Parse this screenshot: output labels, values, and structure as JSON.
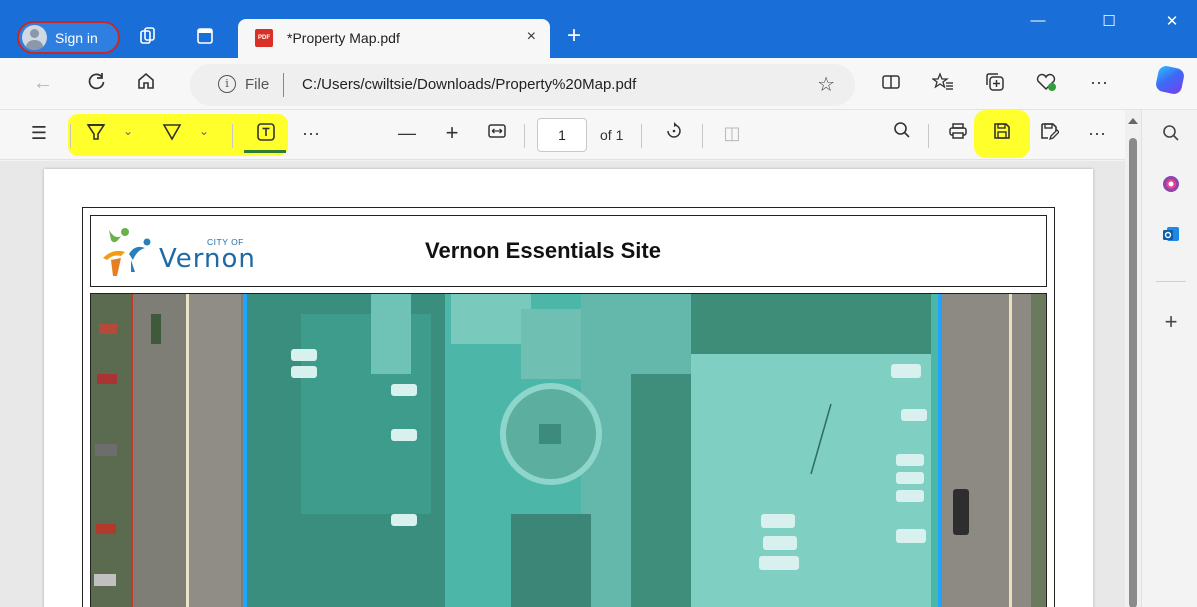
{
  "browser": {
    "sign_in_label": "Sign in",
    "tab": {
      "title": "*Property Map.pdf",
      "file_icon_text": "PDF"
    },
    "window_controls": {
      "minimize": "—",
      "maximize": "☐",
      "close": "✕"
    },
    "address": {
      "scheme_label": "File",
      "url": "C:/Users/cwiltsie/Downloads/Property%20Map.pdf"
    },
    "icons": {
      "back": "←",
      "refresh": "C",
      "home": "⌂",
      "favorite": "☆",
      "split_screen": "◫",
      "favorites": "☆≡",
      "collections": "⧉",
      "performance": "♡",
      "more": "···",
      "new_tab": "+",
      "tab_close": "×"
    }
  },
  "pdf_toolbar": {
    "contents": "☰",
    "highlight": "▽",
    "draw": "▽",
    "chevron": "⌄",
    "text": "T",
    "more": "···",
    "zoom_out": "—",
    "zoom_in": "+",
    "fit": "↔",
    "page_number": "1",
    "page_total": "of 1",
    "rotate": "↻",
    "two_page": "◫",
    "search": "⚲",
    "print": "⎙",
    "save": "🖫",
    "save_as": "🖫",
    "overflow": "···",
    "highlight_color": "#ffff2b"
  },
  "document": {
    "title": "Vernon Essentials Site",
    "logo": {
      "city_of": "CITY OF",
      "name": "Vernon"
    }
  },
  "sidebar": {
    "search": "⚲",
    "add": "+"
  }
}
